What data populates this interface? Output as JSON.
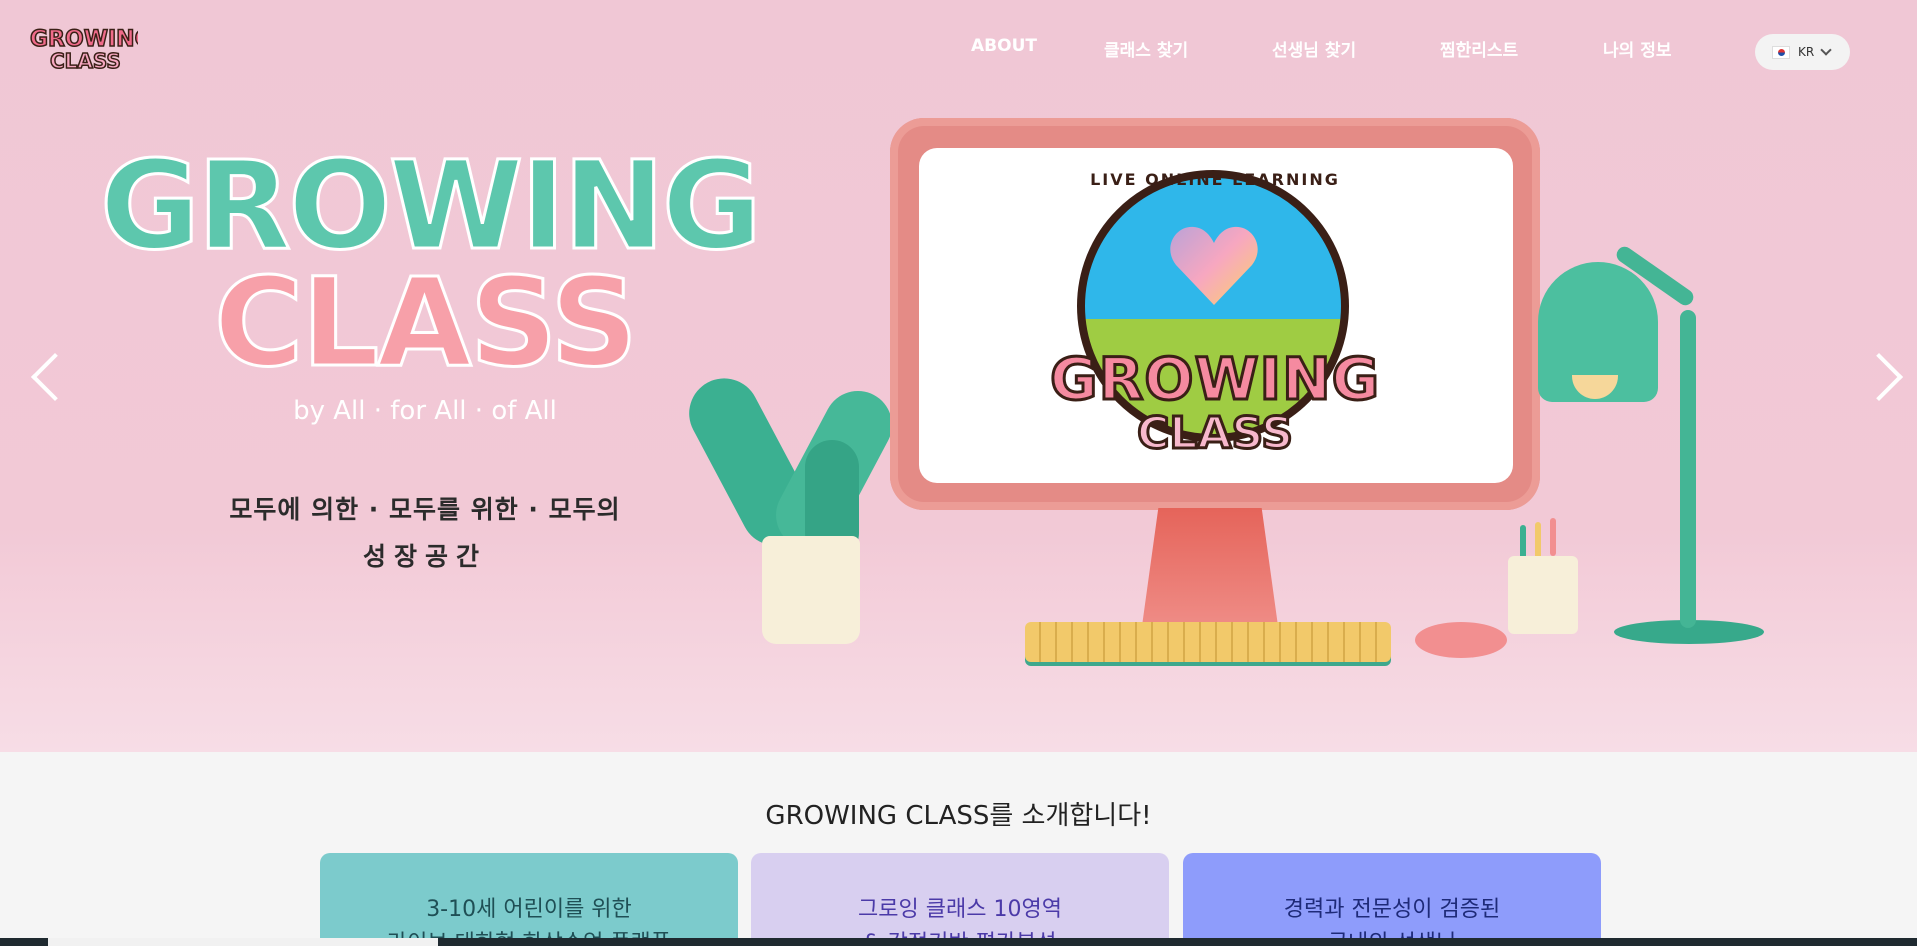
{
  "nav": {
    "about": "ABOUT",
    "find_class": "클래스 찾기",
    "find_teacher": "선생님 찾기",
    "wishlist": "찜한리스트",
    "my_info": "나의 정보",
    "lang": "KR"
  },
  "hero": {
    "title_line1": "GROWING",
    "title_line2": "CLASS",
    "tagline": "by All · for All · of All",
    "korean_line1": "모두에 의한 · 모두를 위한 · 모두의",
    "korean_line2": "성장공간",
    "screen_logo": {
      "arc_text": "LIVE ONLINE LEARNING",
      "word1": "GROWING",
      "word2": "CLASS"
    }
  },
  "intro": {
    "title": "GROWING CLASS를 소개합니다!",
    "cards": [
      {
        "line1": "3-10세 어린이를 위한",
        "line2": "라이브 대화형 화상수업 플랫폼"
      },
      {
        "line1": "그로잉 클래스 10영역",
        "line2": "& 강점기반 평가분석"
      },
      {
        "line1": "경력과 전문성이 검증된",
        "line2": "국내외 선생님"
      }
    ]
  },
  "colors": {
    "hero_bg": "#f2c9d6",
    "title_green": "#5dc7ad",
    "title_pink": "#f7a0a9",
    "card1": "#7ccbcc",
    "card2": "#d8cff0",
    "card3": "#8e9cfb"
  }
}
